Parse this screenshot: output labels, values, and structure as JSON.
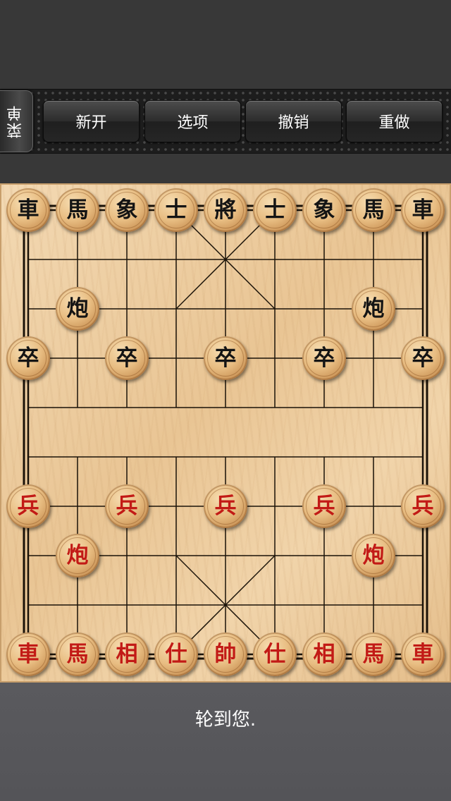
{
  "toolbar": {
    "menu_label": "菜单",
    "buttons": [
      "新开",
      "选项",
      "撤销",
      "重做"
    ]
  },
  "board": {
    "files": 9,
    "ranks": 10,
    "pieces": [
      {
        "char": "車",
        "side": "black",
        "file": 0,
        "rank": 0
      },
      {
        "char": "馬",
        "side": "black",
        "file": 1,
        "rank": 0
      },
      {
        "char": "象",
        "side": "black",
        "file": 2,
        "rank": 0
      },
      {
        "char": "士",
        "side": "black",
        "file": 3,
        "rank": 0
      },
      {
        "char": "將",
        "side": "black",
        "file": 4,
        "rank": 0
      },
      {
        "char": "士",
        "side": "black",
        "file": 5,
        "rank": 0
      },
      {
        "char": "象",
        "side": "black",
        "file": 6,
        "rank": 0
      },
      {
        "char": "馬",
        "side": "black",
        "file": 7,
        "rank": 0
      },
      {
        "char": "車",
        "side": "black",
        "file": 8,
        "rank": 0
      },
      {
        "char": "炮",
        "side": "black",
        "file": 1,
        "rank": 2
      },
      {
        "char": "炮",
        "side": "black",
        "file": 7,
        "rank": 2
      },
      {
        "char": "卒",
        "side": "black",
        "file": 0,
        "rank": 3
      },
      {
        "char": "卒",
        "side": "black",
        "file": 2,
        "rank": 3
      },
      {
        "char": "卒",
        "side": "black",
        "file": 4,
        "rank": 3
      },
      {
        "char": "卒",
        "side": "black",
        "file": 6,
        "rank": 3
      },
      {
        "char": "卒",
        "side": "black",
        "file": 8,
        "rank": 3
      },
      {
        "char": "兵",
        "side": "red",
        "file": 0,
        "rank": 6
      },
      {
        "char": "兵",
        "side": "red",
        "file": 2,
        "rank": 6
      },
      {
        "char": "兵",
        "side": "red",
        "file": 4,
        "rank": 6
      },
      {
        "char": "兵",
        "side": "red",
        "file": 6,
        "rank": 6
      },
      {
        "char": "兵",
        "side": "red",
        "file": 8,
        "rank": 6
      },
      {
        "char": "炮",
        "side": "red",
        "file": 1,
        "rank": 7
      },
      {
        "char": "炮",
        "side": "red",
        "file": 7,
        "rank": 7
      },
      {
        "char": "車",
        "side": "red",
        "file": 0,
        "rank": 9
      },
      {
        "char": "馬",
        "side": "red",
        "file": 1,
        "rank": 9
      },
      {
        "char": "相",
        "side": "red",
        "file": 2,
        "rank": 9
      },
      {
        "char": "仕",
        "side": "red",
        "file": 3,
        "rank": 9
      },
      {
        "char": "帥",
        "side": "red",
        "file": 4,
        "rank": 9
      },
      {
        "char": "仕",
        "side": "red",
        "file": 5,
        "rank": 9
      },
      {
        "char": "相",
        "side": "red",
        "file": 6,
        "rank": 9
      },
      {
        "char": "馬",
        "side": "red",
        "file": 7,
        "rank": 9
      },
      {
        "char": "車",
        "side": "red",
        "file": 8,
        "rank": 9
      }
    ]
  },
  "status": {
    "text": "轮到您."
  }
}
